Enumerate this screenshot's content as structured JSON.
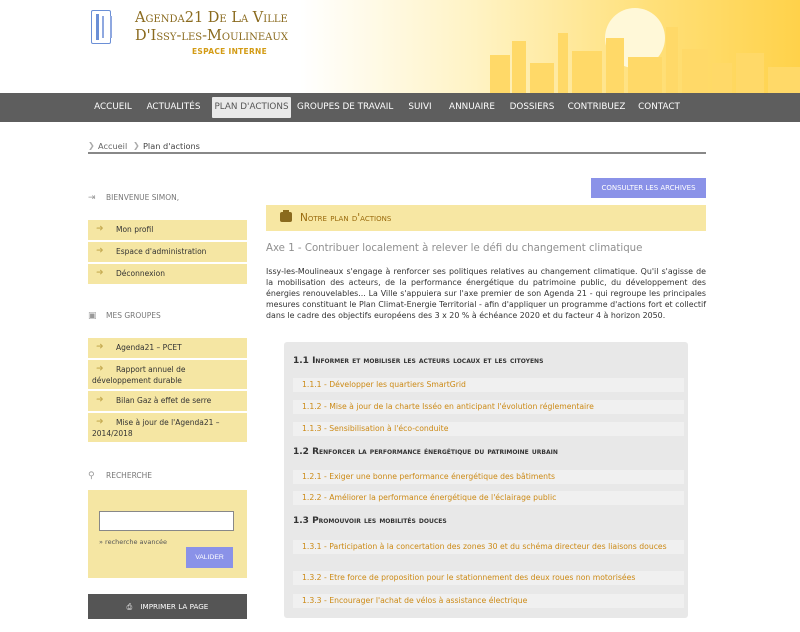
{
  "header": {
    "title_line1": "Agenda21 De La Ville",
    "title_line2": "D'Issy-les-Moulineaux",
    "subtitle": "ESPACE INTERNE"
  },
  "nav": {
    "items": [
      {
        "label": "ACCUEIL"
      },
      {
        "label": "ACTUALITÉS"
      },
      {
        "label": "PLAN D'ACTIONS"
      },
      {
        "label": "GROUPES DE TRAVAIL"
      },
      {
        "label": "SUIVI"
      },
      {
        "label": "ANNUAIRE"
      },
      {
        "label": "DOSSIERS"
      },
      {
        "label": "CONTRIBUEZ"
      },
      {
        "label": "CONTACT"
      }
    ],
    "active": "PLAN D'ACTIONS"
  },
  "breadcrumb": {
    "home": "Accueil",
    "current": "Plan d'actions"
  },
  "sidebar": {
    "welcome": "BIENVENUE SIMON,",
    "account_items": [
      {
        "label": "Mon profil"
      },
      {
        "label": "Espace d'administration"
      },
      {
        "label": "Déconnexion"
      }
    ],
    "groups_heading": "MES GROUPES",
    "group_items": [
      {
        "label": "Agenda21 – PCET"
      },
      {
        "label": "Rapport annuel de développement durable"
      },
      {
        "label": "Bilan Gaz à effet de serre"
      },
      {
        "label": "Mise à jour de l'Agenda21 – 2014/2018"
      }
    ],
    "search_heading": "RECHERCHE",
    "search_value": "",
    "advanced_search": "» recherche avancée",
    "validate_label": "VALIDER",
    "print_label": "IMPRIMER LA PAGE"
  },
  "main": {
    "archives_label": "CONSULTER LES ARCHIVES",
    "section_title": "Notre plan d'actions",
    "axe_title": "Axe 1 - Contribuer localement à relever le défi du changement climatique",
    "intro": "Issy-les-Moulineaux  s'engage à renforcer ses politiques relatives au changement climatique. Qu'il s'agisse de la mobilisation des acteurs, de la performance énergétique du patrimoine public, du développement des énergies renouvelables... La Ville s'appuiera sur l'axe premier de son Agenda 21 - qui regroupe les principales mesures constituant le Plan Climat-Energie Territorial - afin d'appliquer un programme d'actions fort et collectif dans le cadre des objectifs européens des 3 x 20 % à échéance 2020 et du facteur 4 à horizon 2050.",
    "sections": [
      {
        "title": "1.1 Informer et mobiliser les acteurs locaux et les citoyens",
        "items": [
          {
            "label": "1.1.1 - Développer les quartiers SmartGrid"
          },
          {
            "label": "1.1.2 - Mise à jour de la charte Isséo en anticipant l'évolution réglementaire"
          },
          {
            "label": "1.1.3 - Sensibilisation à l'éco-conduite"
          }
        ]
      },
      {
        "title": "1.2 Renforcer la performance énergétique du patrimoine urbain",
        "items": [
          {
            "label": "1.2.1 - Exiger une bonne performance énergétique des bâtiments"
          },
          {
            "label": "1.2.2 - Améliorer la performance énergétique de l'éclairage public"
          }
        ]
      },
      {
        "title": "1.3 Promouvoir les mobilités douces",
        "items": [
          {
            "label": "1.3.1 - Participation à la concertation des zones 30 et du schéma directeur des liaisons douces"
          },
          {
            "label": "1.3.2 - Etre force de proposition pour le stationnement des deux roues non motorisées"
          },
          {
            "label": "1.3.3 - Encourager l'achat de vélos à assistance électrique"
          }
        ]
      }
    ]
  }
}
